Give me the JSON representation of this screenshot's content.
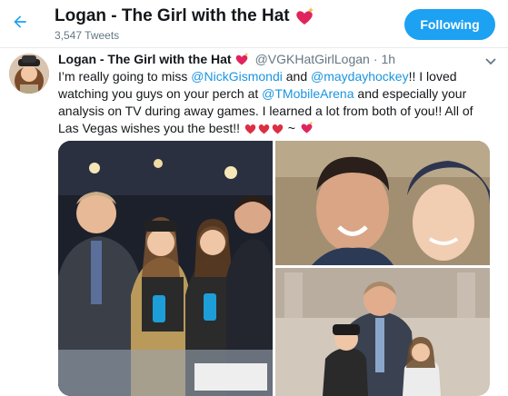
{
  "header": {
    "title": "Logan - The Girl with the Hat",
    "tweet_count": "3,547 Tweets",
    "follow_label": "Following"
  },
  "tweet": {
    "name": "Logan - The Girl with the Hat",
    "handle": "@VGKHatGirlLogan",
    "separator": "·",
    "time": "1h",
    "text_1": "I’m really going to miss ",
    "mention_1": "@NickGismondi",
    "text_2": " and ",
    "mention_2": "@maydayhockey",
    "text_3": "!!  I loved watching you guys on your perch at ",
    "mention_3": "@TMobileArena",
    "text_4": " and especially your analysis on TV during away games. I learned a lot from both of you!!  All of Las Vegas wishes you the best!!  ",
    "text_5": " ~ "
  },
  "icons": {
    "back": "arrow-left-icon",
    "heart": "sparkling-heart-emoji",
    "red_heart": "red-heart-emoji",
    "caret": "chevron-down-icon"
  },
  "colors": {
    "accent": "#1da1f2",
    "link": "#1b95e0",
    "muted": "#657786",
    "heart": "#e0245e"
  }
}
